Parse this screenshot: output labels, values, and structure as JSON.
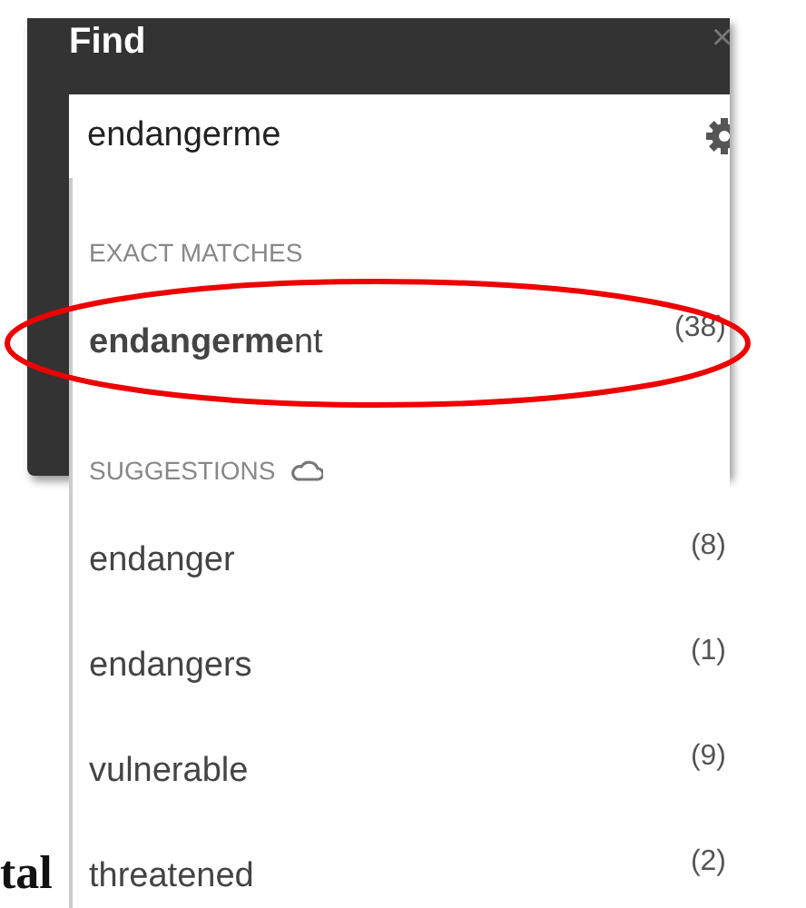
{
  "panel": {
    "title": "Find",
    "close": "×",
    "search": {
      "value": "endangerme"
    }
  },
  "sections": [
    {
      "heading": "EXACT MATCHES",
      "kind": "exact",
      "items": [
        {
          "term": "**endangerme**nt",
          "count": "(38)",
          "circled": true
        }
      ]
    },
    {
      "heading": "SUGGESTIONS",
      "kind": "suggestions",
      "items": [
        {
          "term": "endanger",
          "count": "(8)",
          "circled": false
        },
        {
          "term": "endangers",
          "count": "(1)",
          "circled": false
        },
        {
          "term": "vulnerable",
          "count": "(9)",
          "circled": false
        },
        {
          "term": "threatened",
          "count": "(2)",
          "circled": false
        }
      ]
    }
  ],
  "document_fragment": "tal"
}
